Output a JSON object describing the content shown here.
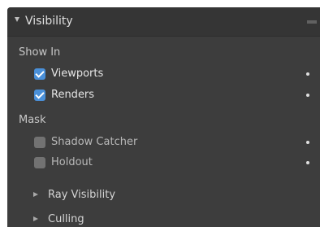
{
  "panel": {
    "title": "Visibility",
    "show_in": {
      "label": "Show In",
      "items": [
        {
          "label": "Viewports",
          "checked": true
        },
        {
          "label": "Renders",
          "checked": true
        }
      ]
    },
    "mask": {
      "label": "Mask",
      "items": [
        {
          "label": "Shadow Catcher",
          "checked": false
        },
        {
          "label": "Holdout",
          "checked": false
        }
      ]
    },
    "subpanels": [
      {
        "label": "Ray Visibility",
        "expanded": false
      },
      {
        "label": "Culling",
        "expanded": false
      }
    ]
  },
  "colors": {
    "panel_bg": "#3d3d3d",
    "header_bg": "#353535",
    "checkbox_checked": "#4a90d9",
    "checkbox_unchecked": "#727272",
    "text": "#e6e6e6"
  }
}
